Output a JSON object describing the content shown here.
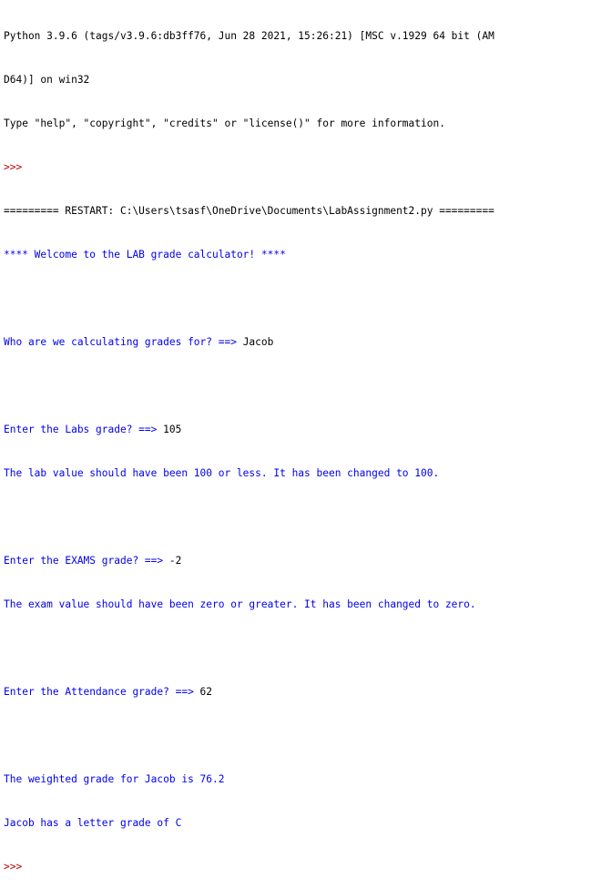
{
  "header": {
    "line1": "Python 3.9.6 (tags/v3.9.6:db3ff76, Jun 28 2021, 15:26:21) [MSC v.1929 64 bit (AM",
    "line2": "D64)] on win32",
    "line3": "Type \"help\", \"copyright\", \"credits\" or \"license()\" for more information.",
    "prompt": ">>>"
  },
  "restart": "========= RESTART: C:\\Users\\tsasf\\OneDrive\\Documents\\LabAssignment2.py =========",
  "welcome": "**** Welcome to the LAB grade calculator! ****",
  "name_prompt": "Who are we calculating grades for? ==> ",
  "name_value": "Jacob",
  "labs_prompt": "Enter the Labs grade? ==> ",
  "labs_value": "105",
  "labs_msg": "The lab value should have been 100 or less. It has been changed to 100.",
  "exams_prompt": "Enter the EXAMS grade? ==> ",
  "exams_value": "-2",
  "exams_msg": "The exam value should have been zero or greater. It has been changed to zero.",
  "attendance_prompt": "Enter the Attendance grade? ==> ",
  "attendance_value": "62",
  "result_weighted": "The weighted grade for Jacob is 76.2",
  "result_letter": "Jacob has a letter grade of C",
  "final_prompt": ">>>"
}
